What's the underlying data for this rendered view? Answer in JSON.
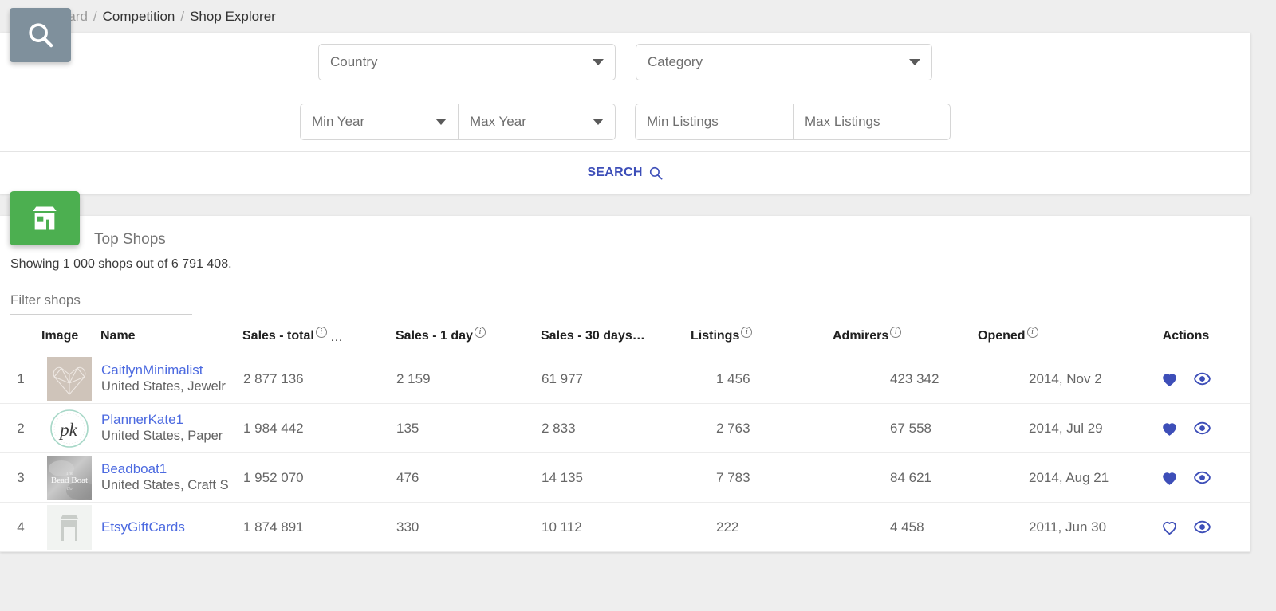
{
  "breadcrumb": {
    "sep": "/",
    "items": [
      {
        "label": "Dashboard",
        "active": false
      },
      {
        "label": "Competition",
        "active": false
      },
      {
        "label": "Shop Explorer",
        "active": true
      }
    ]
  },
  "search_panel": {
    "search_icon": "search-icon",
    "country": {
      "label": "Country",
      "caret": "chevron-down-icon"
    },
    "category": {
      "label": "Category",
      "caret": "chevron-down-icon"
    },
    "min_year": {
      "label": "Min Year",
      "caret": "chevron-down-icon"
    },
    "max_year": {
      "label": "Max Year",
      "caret": "chevron-down-icon"
    },
    "min_listings": {
      "placeholder": "Min Listings",
      "value": ""
    },
    "max_listings": {
      "placeholder": "Max Listings",
      "value": ""
    },
    "search_button": {
      "label": "SEARCH",
      "icon": "search-icon",
      "color": "#3d4eb8"
    }
  },
  "results_panel": {
    "icon": "storefront-icon",
    "icon_color": "#4caf50",
    "title": "Top Shops",
    "showing": "Showing 1 000 shops out of 6 791 408.",
    "filter_input": {
      "placeholder": "Filter shops",
      "value": ""
    },
    "columns": [
      {
        "key": "index",
        "label": "",
        "info": false
      },
      {
        "key": "image",
        "label": "Image",
        "info": false
      },
      {
        "key": "name",
        "label": "Name",
        "info": false
      },
      {
        "key": "total",
        "label": "Sales - total",
        "info": true,
        "ellipsis": "…"
      },
      {
        "key": "day1",
        "label": "Sales - 1 day",
        "info": true
      },
      {
        "key": "day30",
        "label": "Sales - 30 days…",
        "info": false
      },
      {
        "key": "listings",
        "label": "Listings",
        "info": true
      },
      {
        "key": "admirers",
        "label": "Admirers",
        "info": true
      },
      {
        "key": "opened",
        "label": "Opened",
        "info": true
      },
      {
        "key": "actions",
        "label": "Actions",
        "info": false
      }
    ],
    "rows": [
      {
        "index": "1",
        "thumb": "geometric-heart-logo",
        "name": "CaitlynMinimalist",
        "sub": "United States, Jewelr",
        "total": "2 877 136",
        "day1": "2 159",
        "day30": "61 977",
        "listings": "1 456",
        "admirers": "423 342",
        "opened": "2014, Nov 2",
        "favorite": true
      },
      {
        "index": "2",
        "thumb": "pk-monogram-logo",
        "name": "PlannerKate1",
        "sub": "United States, Paper",
        "total": "1 984 442",
        "day1": "135",
        "day30": "2 833",
        "listings": "2 763",
        "admirers": "67 558",
        "opened": "2014, Jul 29",
        "favorite": true
      },
      {
        "index": "3",
        "thumb": "bead-boat-logo",
        "name": "Beadboat1",
        "sub": "United States, Craft S",
        "total": "1 952 070",
        "day1": "476",
        "day30": "14 135",
        "listings": "7 783",
        "admirers": "84 621",
        "opened": "2014, Aug 21",
        "favorite": true
      },
      {
        "index": "4",
        "thumb": "storefront-placeholder",
        "name": "EtsyGiftCards",
        "sub": "",
        "total": "1 874 891",
        "day1": "330",
        "day30": "10 112",
        "listings": "222",
        "admirers": "4 458",
        "opened": "2011, Jun 30",
        "favorite": false
      }
    ],
    "action_icons": {
      "favorite": "heart-icon",
      "view": "eye-icon",
      "color": "#3d4eb8"
    }
  }
}
